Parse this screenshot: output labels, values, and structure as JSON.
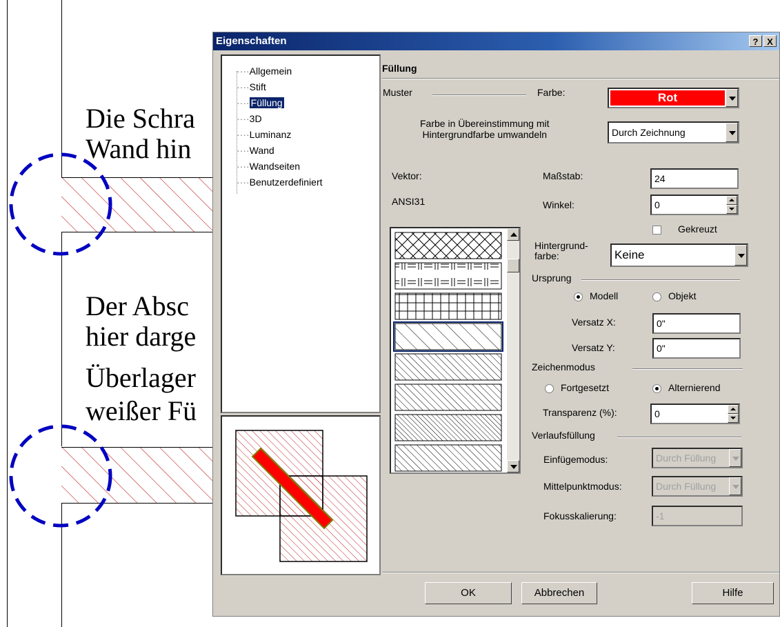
{
  "background_doc": {
    "paragraph1": [
      "Die Schra",
      "Wand hin"
    ],
    "paragraph2": [
      "Der Absc",
      "hier darge",
      "Überlager",
      "weißer Fü"
    ]
  },
  "dialog": {
    "title": "Eigenschaften",
    "help_btn": "?",
    "close_btn": "X",
    "tree": [
      "Allgemein",
      "Stift",
      "Füllung",
      "3D",
      "Luminanz",
      "Wand",
      "Wandseiten",
      "Benutzerdefiniert"
    ],
    "selected_tree_item": "Füllung",
    "section_title": "Füllung",
    "muster_label": "Muster",
    "farbe_label": "Farbe:",
    "farbe_value": "Rot",
    "farbe_color": "#ff0000",
    "convert_label_line1": "Farbe in Übereinstimmung mit",
    "convert_label_line2": "Hintergrundfarbe umwandeln",
    "convert_value": "Durch Zeichnung",
    "vektor_label": "Vektor:",
    "vektor_value": "ANSI31",
    "massstab_label": "Maßstab:",
    "massstab_value": "24",
    "winkel_label": "Winkel:",
    "winkel_value": "0",
    "gekreuzt_label": "Gekreuzt",
    "hintergrund_label_line1": "Hintergrund-",
    "hintergrund_label_line2": "farbe:",
    "hintergrund_value": "Keine",
    "ursprung_label": "Ursprung",
    "modell_label": "Modell",
    "objekt_label": "Objekt",
    "versatz_x_label": "Versatz X:",
    "versatz_x_value": "0\"",
    "versatz_y_label": "Versatz Y:",
    "versatz_y_value": "0\"",
    "zeichenmodus_label": "Zeichenmodus",
    "fortgesetzt_label": "Fortgesetzt",
    "alternierend_label": "Alternierend",
    "transparenz_label": "Transparenz (%):",
    "transparenz_value": "0",
    "verlauf_label": "Verlaufsfüllung",
    "einfuege_label": "Einfügemodus:",
    "einfuege_value": "Durch Füllung",
    "mittelpunkt_label": "Mittelpunktmodus:",
    "mittelpunkt_value": "Durch Füllung",
    "fokus_label": "Fokusskalierung:",
    "fokus_value": "-1",
    "ok_label": "OK",
    "abbrechen_label": "Abbrechen",
    "hilfe_label": "Hilfe"
  },
  "colors": {
    "titlebar": "#0a246a",
    "dialog_bg": "#d4d0c8",
    "hatch": "#c02020",
    "dash_circle": "#0000c0"
  }
}
